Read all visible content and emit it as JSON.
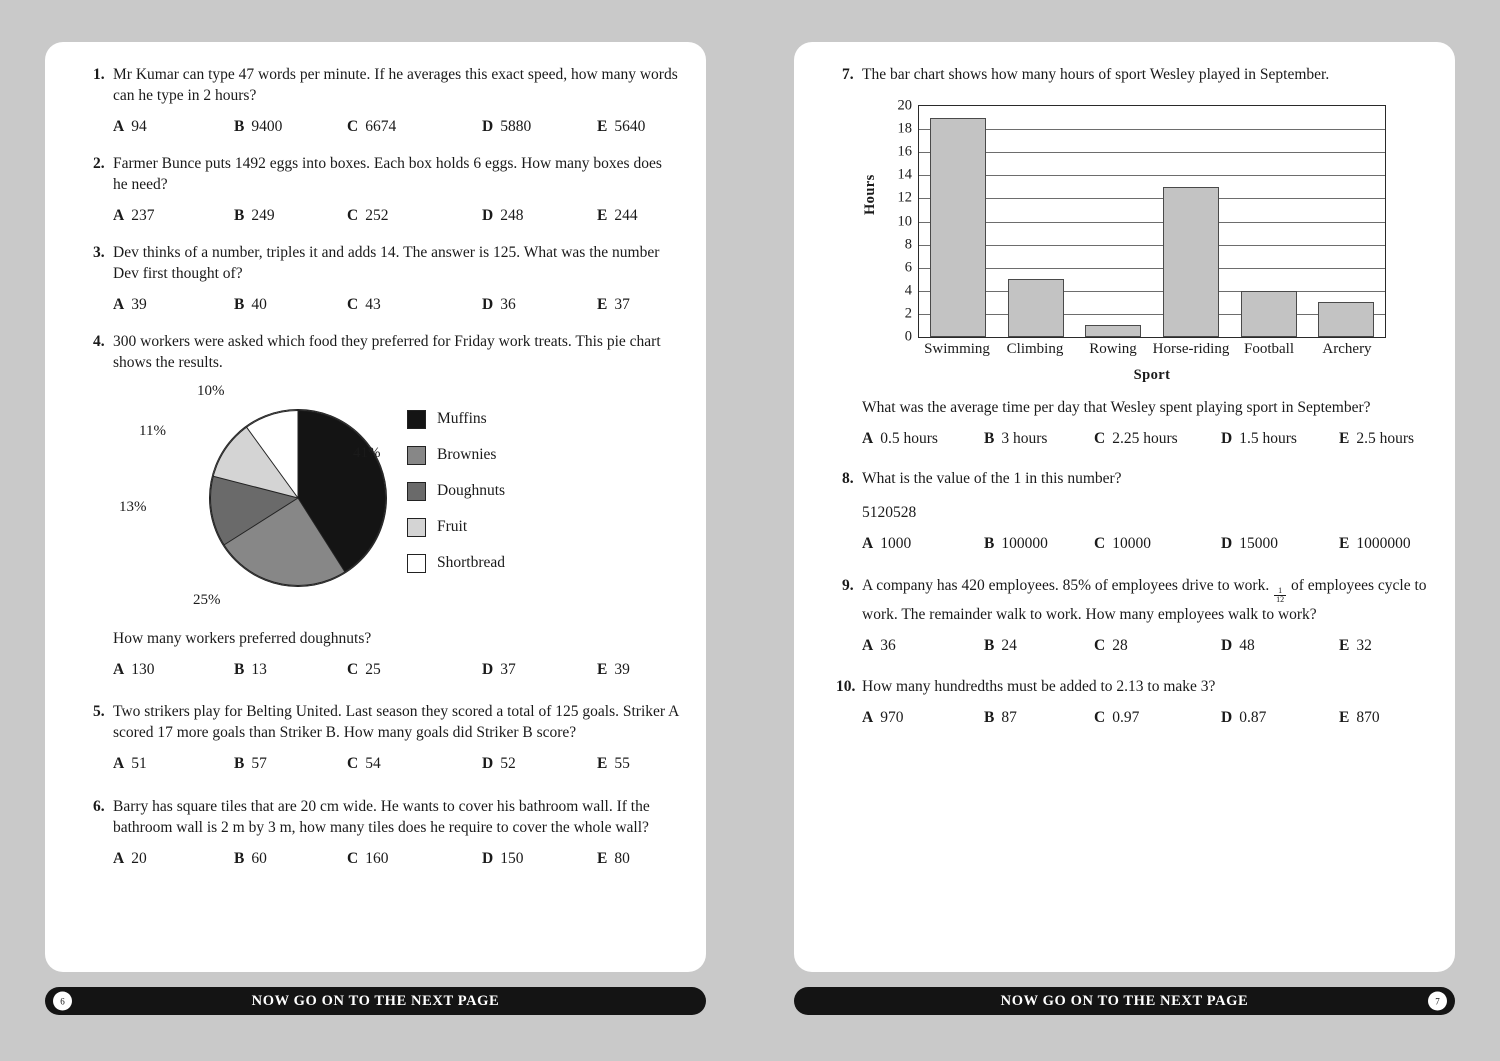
{
  "background_color": "#c9c9c9",
  "pages": {
    "left": {
      "page_number": "6",
      "footer_text": "NOW GO ON TO THE NEXT PAGE"
    },
    "right": {
      "page_number": "7",
      "footer_text": "NOW GO ON TO THE NEXT PAGE"
    }
  },
  "questions": [
    {
      "number": "1.",
      "text": "Mr Kumar can type 47 words per minute. If he averages this exact speed, how many words can he type in 2 hours?",
      "options": [
        {
          "letter": "A",
          "value": "94"
        },
        {
          "letter": "B",
          "value": "9400"
        },
        {
          "letter": "C",
          "value": "6674"
        },
        {
          "letter": "D",
          "value": "5880"
        },
        {
          "letter": "E",
          "value": "5640"
        }
      ]
    },
    {
      "number": "2.",
      "text": "Farmer Bunce puts 1492 eggs into boxes. Each box holds 6 eggs. How many boxes does he need?",
      "options": [
        {
          "letter": "A",
          "value": "237"
        },
        {
          "letter": "B",
          "value": "249"
        },
        {
          "letter": "C",
          "value": "252"
        },
        {
          "letter": "D",
          "value": "248"
        },
        {
          "letter": "E",
          "value": "244"
        }
      ]
    },
    {
      "number": "3.",
      "text": "Dev thinks of a number, triples it and adds 14. The answer is 125. What was the number Dev first thought of?",
      "options": [
        {
          "letter": "A",
          "value": "39"
        },
        {
          "letter": "B",
          "value": "40"
        },
        {
          "letter": "C",
          "value": "43"
        },
        {
          "letter": "D",
          "value": "36"
        },
        {
          "letter": "E",
          "value": "37"
        }
      ]
    },
    {
      "number": "4.",
      "text": "300 workers were asked which food they preferred for Friday work treats. This pie chart shows the results.",
      "sub_text": "How many workers preferred doughnuts?",
      "options": [
        {
          "letter": "A",
          "value": "130"
        },
        {
          "letter": "B",
          "value": "13"
        },
        {
          "letter": "C",
          "value": "25"
        },
        {
          "letter": "D",
          "value": "37"
        },
        {
          "letter": "E",
          "value": "39"
        }
      ]
    },
    {
      "number": "5.",
      "text": "Two strikers play for Belting United. Last season they scored a total of 125 goals. Striker A scored 17 more goals than Striker B. How many goals did Striker B score?",
      "options": [
        {
          "letter": "A",
          "value": "51"
        },
        {
          "letter": "B",
          "value": "57"
        },
        {
          "letter": "C",
          "value": "54"
        },
        {
          "letter": "D",
          "value": "52"
        },
        {
          "letter": "E",
          "value": "55"
        }
      ]
    },
    {
      "number": "6.",
      "text": "Barry has square tiles that are 20 cm wide. He wants to cover his bathroom wall. If the bathroom wall is 2 m by 3 m, how many tiles does he require to cover the whole wall?",
      "options": [
        {
          "letter": "A",
          "value": "20"
        },
        {
          "letter": "B",
          "value": "60"
        },
        {
          "letter": "C",
          "value": "160"
        },
        {
          "letter": "D",
          "value": "150"
        },
        {
          "letter": "E",
          "value": "80"
        }
      ]
    },
    {
      "number": "7.",
      "text": "The bar chart shows how many hours of sport Wesley played in September.",
      "sub_text": "What was the average time per day that Wesley spent playing sport in September?",
      "options": [
        {
          "letter": "A",
          "value": "0.5 hours"
        },
        {
          "letter": "B",
          "value": "3 hours"
        },
        {
          "letter": "C",
          "value": "2.25 hours"
        },
        {
          "letter": "D",
          "value": "1.5 hours"
        },
        {
          "letter": "E",
          "value": "2.5 hours"
        }
      ]
    },
    {
      "number": "8.",
      "text": "What is the value of the 1 in this number?",
      "sub_text": "5120528",
      "options": [
        {
          "letter": "A",
          "value": "1000"
        },
        {
          "letter": "B",
          "value": "100000"
        },
        {
          "letter": "C",
          "value": "10000"
        },
        {
          "letter": "D",
          "value": "15000"
        },
        {
          "letter": "E",
          "value": "1000000"
        }
      ]
    },
    {
      "number": "9.",
      "text_part1": "A company has 420 employees. 85% of employees drive to work. ",
      "fraction": {
        "numerator": "1",
        "denominator": "12"
      },
      "text_part2": " of employees cycle to work. The remainder walk to work. How many employees walk to work?",
      "options": [
        {
          "letter": "A",
          "value": "36"
        },
        {
          "letter": "B",
          "value": "24"
        },
        {
          "letter": "C",
          "value": "28"
        },
        {
          "letter": "D",
          "value": "48"
        },
        {
          "letter": "E",
          "value": "32"
        }
      ]
    },
    {
      "number": "10.",
      "text": "How many hundredths must be added to 2.13 to make 3?",
      "options": [
        {
          "letter": "A",
          "value": "970"
        },
        {
          "letter": "B",
          "value": "87"
        },
        {
          "letter": "C",
          "value": "0.97"
        },
        {
          "letter": "D",
          "value": "0.87"
        },
        {
          "letter": "E",
          "value": "870"
        }
      ]
    }
  ],
  "chart_data": [
    {
      "type": "pie",
      "title": "",
      "categories": [
        "Muffins",
        "Brownies",
        "Doughnuts",
        "Fruit",
        "Shortbread"
      ],
      "values": [
        41,
        25,
        13,
        11,
        10
      ],
      "labels": [
        "41%",
        "25%",
        "13%",
        "11%",
        "10%"
      ],
      "colors": [
        "#141414",
        "#878787",
        "#6a6a6a",
        "#d4d4d4",
        "#ffffff"
      ],
      "legend_position": "right",
      "unit": "%"
    },
    {
      "type": "bar",
      "title": "",
      "categories": [
        "Swimming",
        "Climbing",
        "Rowing",
        "Horse-riding",
        "Football",
        "Archery"
      ],
      "values": [
        19,
        5,
        1,
        13,
        4,
        3
      ],
      "xlabel": "Sport",
      "ylabel": "Hours",
      "ylim": [
        0,
        20
      ],
      "yticks": [
        "20",
        "18",
        "16",
        "14",
        "12",
        "10",
        "8",
        "6",
        "4",
        "2",
        "0"
      ],
      "grid": true,
      "bar_color": "#c3c3c3"
    }
  ]
}
